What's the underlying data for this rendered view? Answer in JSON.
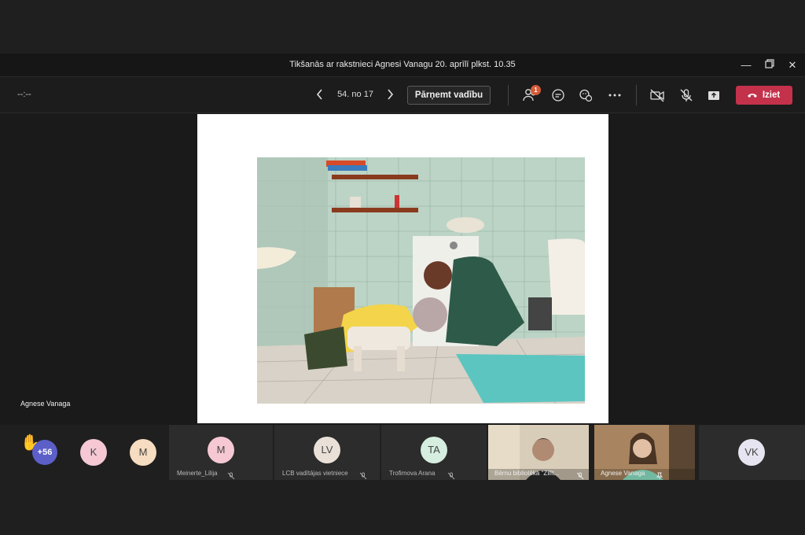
{
  "window": {
    "title": "Tikšanās ar rakstnieci Agnesi Vanagu 20. aprīlī plkst. 10.35",
    "minimize_icon": "minimize-icon",
    "restore_icon": "restore-icon",
    "close_icon": "close-icon"
  },
  "toolbar": {
    "timer": "--:--",
    "slide_counter": "54. no 17",
    "take_control_label": "Pārņemt vadību",
    "participants_badge": "1",
    "leave_label": "Iziet"
  },
  "stage": {
    "presenter_name": "Agnese Vanaga"
  },
  "gallery": {
    "overflow_count": "+56",
    "avatars": [
      {
        "initials": "K",
        "color": "#f5c8d4"
      },
      {
        "initials": "M",
        "color": "#f6dcc0"
      }
    ],
    "tiles": [
      {
        "initials": "M",
        "name": "Meinerte_Lilija",
        "color": "#f5c8d4"
      },
      {
        "initials": "LV",
        "name": "LCB vadītājas vietniece",
        "color": "#e9e1d8"
      },
      {
        "initials": "TA",
        "name": "Trofimova Arana",
        "color": "#d5eee0"
      }
    ],
    "video_tiles": [
      {
        "name": "Bērnu bibliotēka \"Zilīt..."
      },
      {
        "name": "Agnese Vanaga"
      }
    ],
    "last_tile": {
      "initials": "VK",
      "color": "#e6e4f0"
    }
  },
  "colors": {
    "leave": "#c4314b",
    "badge": "#d65b36",
    "overflow": "#5b5fc7"
  }
}
